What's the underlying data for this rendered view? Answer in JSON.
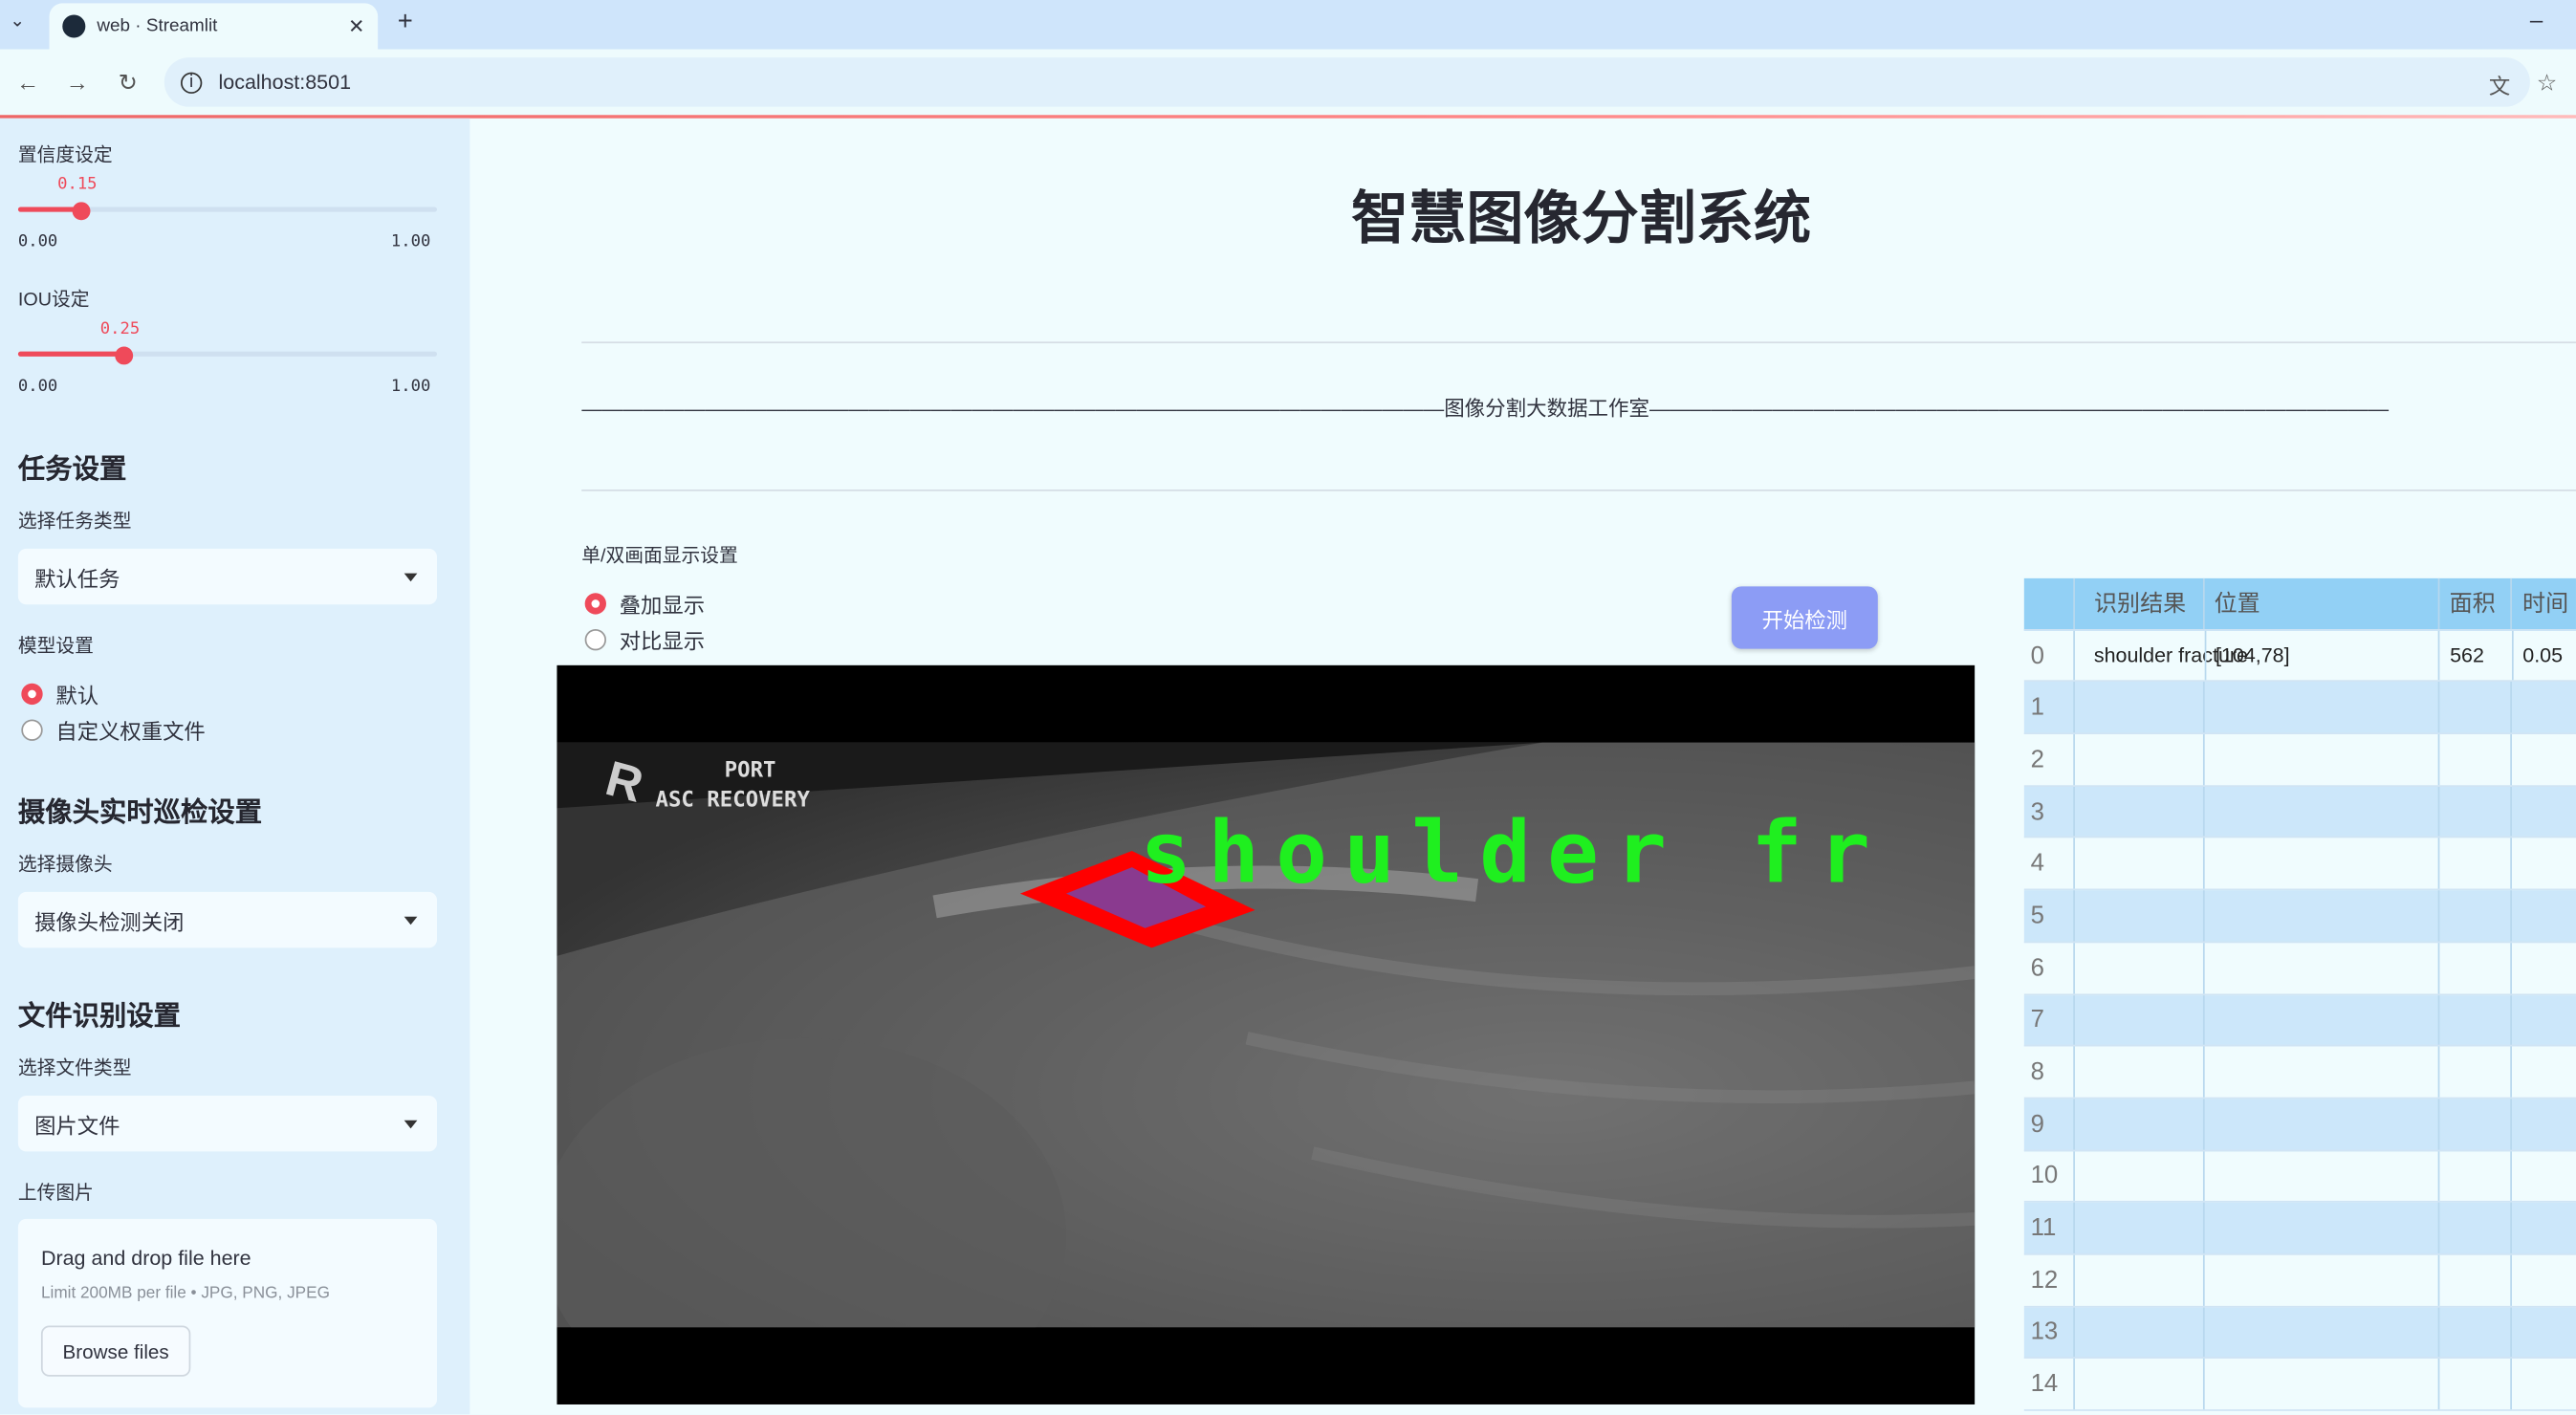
{
  "browser": {
    "tab_title": "web · Streamlit",
    "url": "localhost:8501"
  },
  "sidebar": {
    "confidence": {
      "label": "置信度设定",
      "value": "0.15",
      "min": "0.00",
      "max": "1.00",
      "fraction": 0.15
    },
    "iou": {
      "label": "IOU设定",
      "value": "0.25",
      "min": "0.00",
      "max": "1.00",
      "fraction": 0.25
    },
    "task_heading": "任务设置",
    "task_type_label": "选择任务类型",
    "task_type_value": "默认任务",
    "model_label": "模型设置",
    "model_options": [
      "默认",
      "自定义权重文件"
    ],
    "camera_heading": "摄像头实时巡检设置",
    "camera_label": "选择摄像头",
    "camera_value": "摄像头检测关闭",
    "file_heading": "文件识别设置",
    "file_type_label": "选择文件类型",
    "file_type_value": "图片文件",
    "upload_label": "上传图片",
    "upload_drag": "Drag and drop file here",
    "upload_limit": "Limit 200MB per file • JPG, PNG, JPEG",
    "browse_label": "Browse files"
  },
  "main": {
    "title": "智慧图像分割系统",
    "divider_text": "——————————————————————————————————————————图像分割大数据工作室——————————————————————————————————————————",
    "display_label": "单/双画面显示设置",
    "display_options": [
      "叠加显示",
      "对比显示"
    ],
    "start_button": "开始检测",
    "image": {
      "header_line1": "PORT",
      "header_line2": "ASC RECOVERY",
      "marker": "R",
      "detection_label": "shoulder fr"
    }
  },
  "table": {
    "headers": [
      "",
      "识别结果",
      "位置",
      "面积",
      "时间"
    ],
    "rows": [
      [
        "0",
        "shoulder fracture",
        "[104,78]",
        "562",
        "0.05"
      ],
      [
        "1",
        "",
        "",
        "",
        ""
      ],
      [
        "2",
        "",
        "",
        "",
        ""
      ],
      [
        "3",
        "",
        "",
        "",
        ""
      ],
      [
        "4",
        "",
        "",
        "",
        ""
      ],
      [
        "5",
        "",
        "",
        "",
        ""
      ],
      [
        "6",
        "",
        "",
        "",
        ""
      ],
      [
        "7",
        "",
        "",
        "",
        ""
      ],
      [
        "8",
        "",
        "",
        "",
        ""
      ],
      [
        "9",
        "",
        "",
        "",
        ""
      ],
      [
        "10",
        "",
        "",
        "",
        ""
      ],
      [
        "11",
        "",
        "",
        "",
        ""
      ],
      [
        "12",
        "",
        "",
        "",
        ""
      ],
      [
        "13",
        "",
        "",
        "",
        ""
      ],
      [
        "14",
        "",
        "",
        "",
        ""
      ]
    ]
  },
  "colors": {
    "accent": "#ef4a5a",
    "button": "#8c9cf5",
    "detection": "#00ff00",
    "mask": "#ff0000"
  }
}
